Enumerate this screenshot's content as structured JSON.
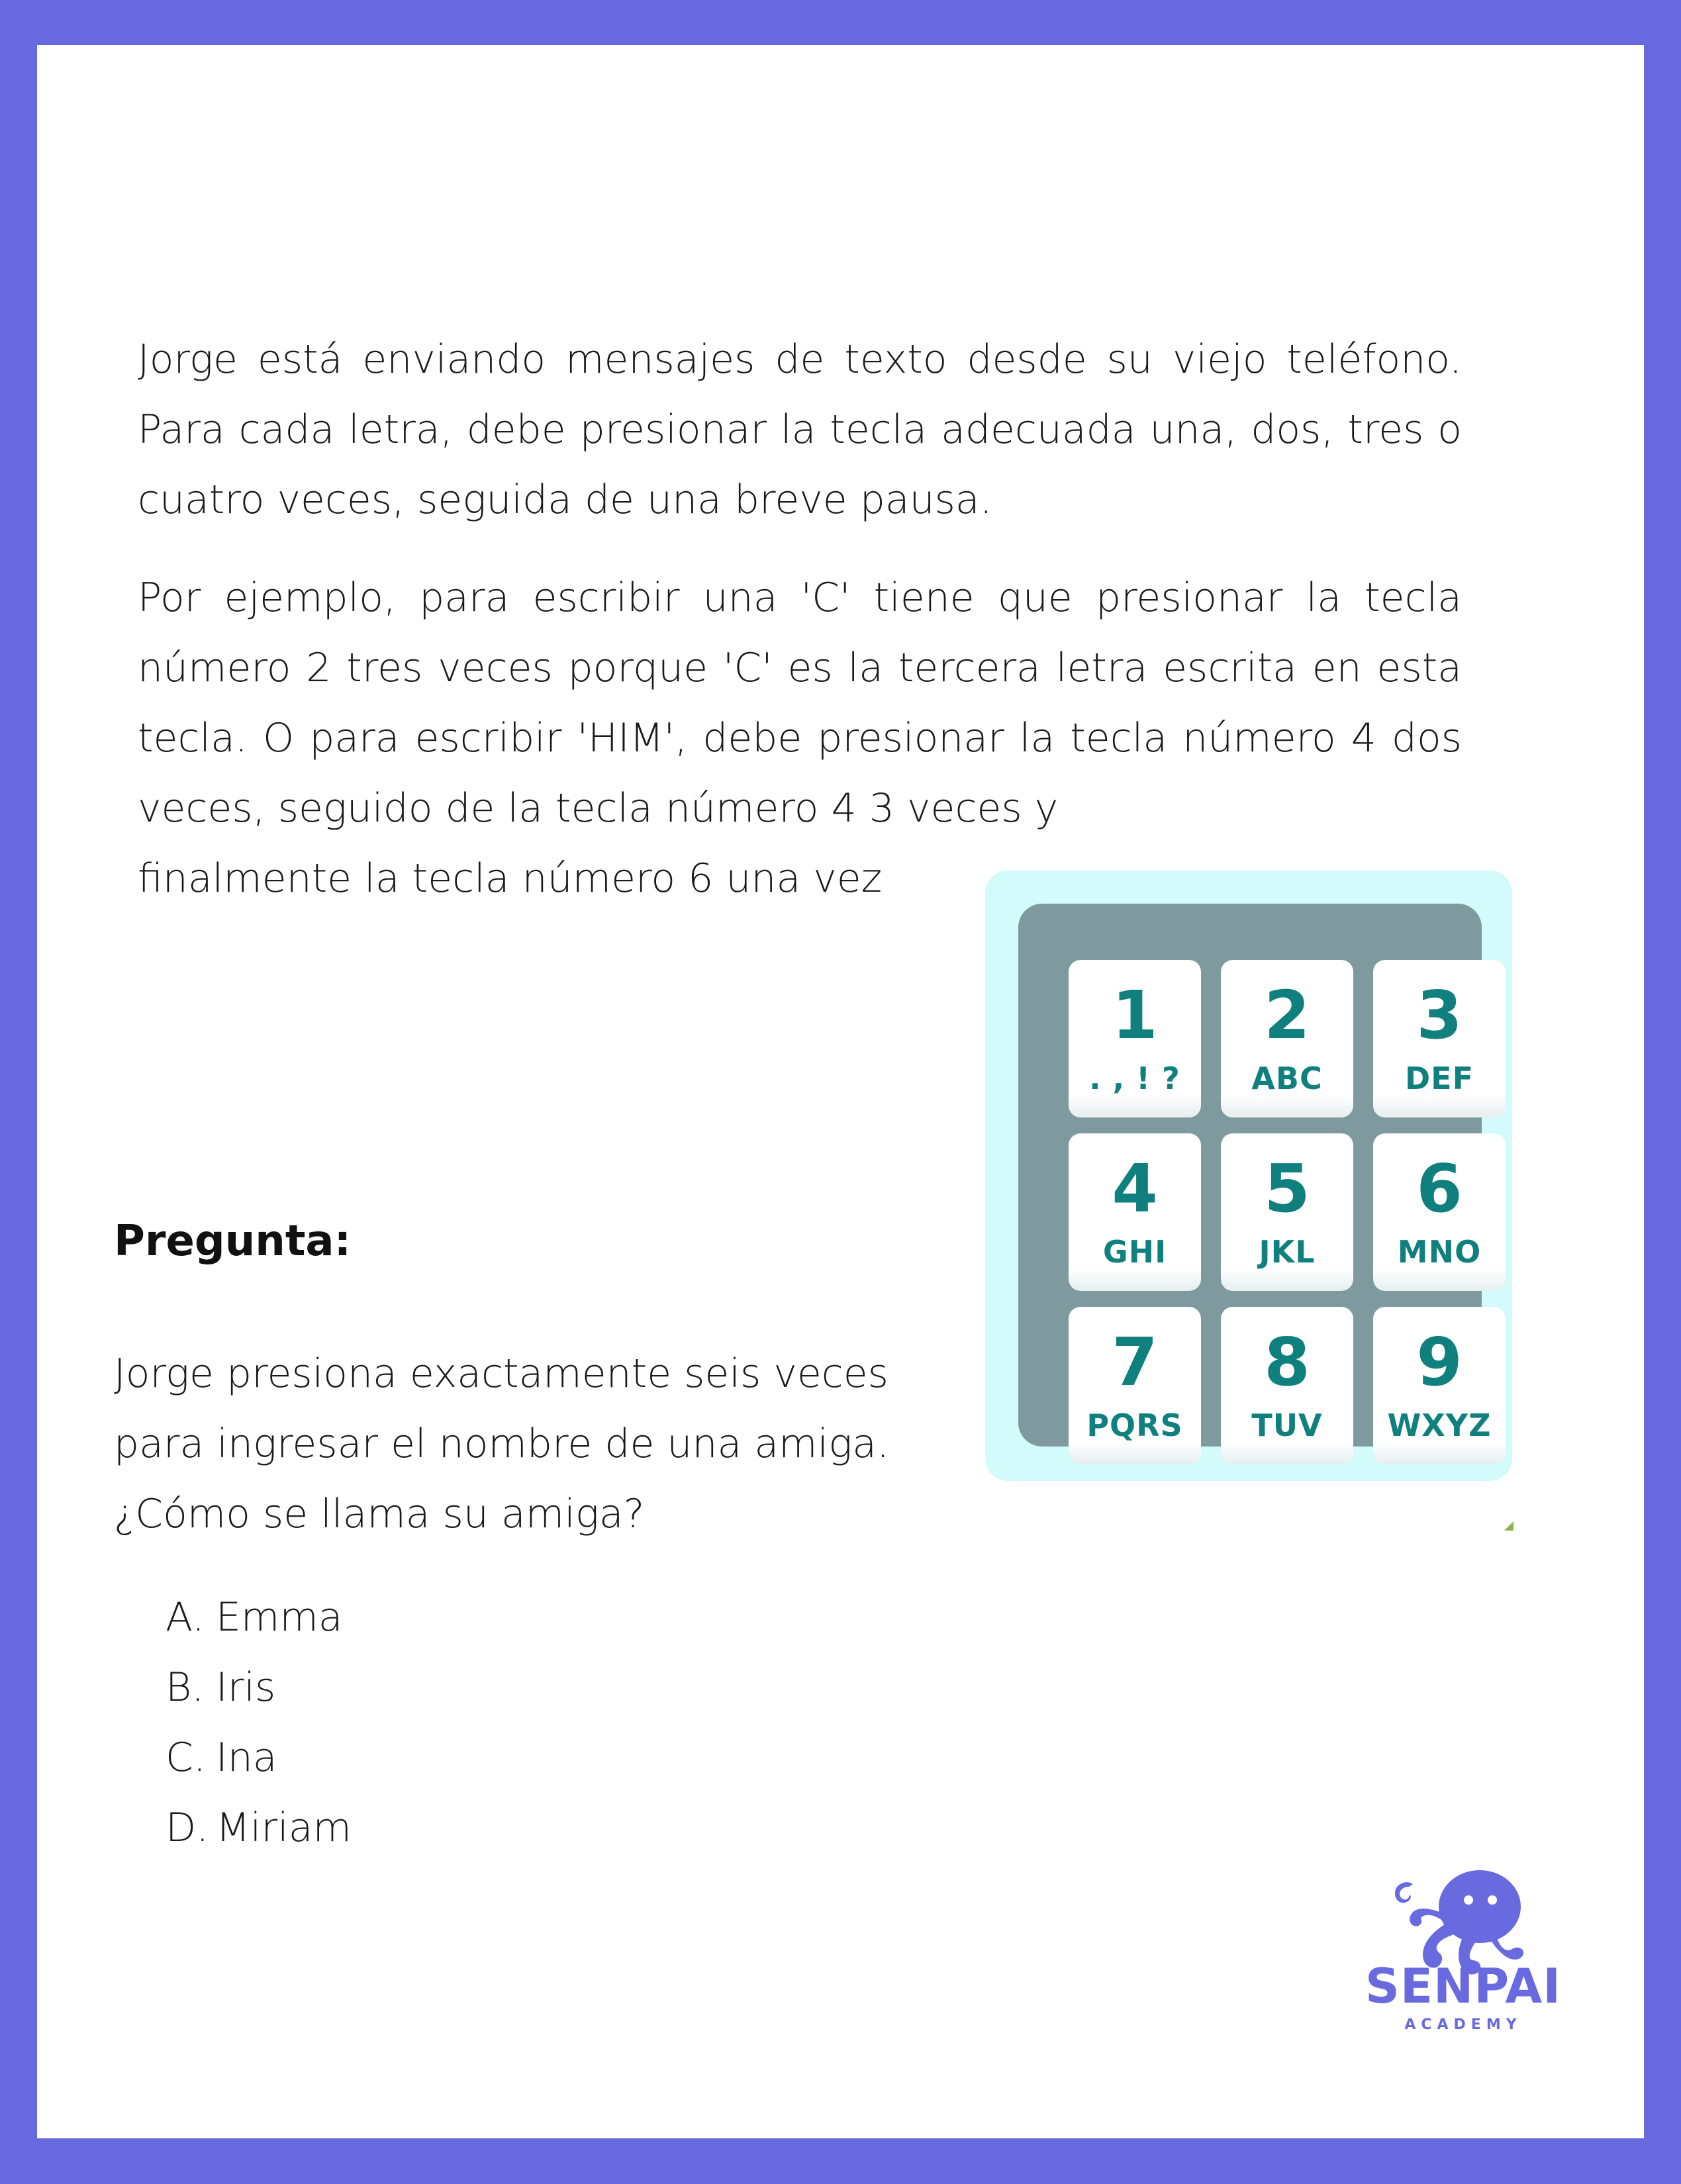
{
  "problem": {
    "paragraph1": "Jorge está enviando mensajes de texto desde su viejo teléfono. Para cada letra, debe presionar la tecla adecuada una, dos, tres o cuatro veces, seguida de una breve pausa.",
    "paragraph2": "Por ejemplo, para escribir una 'C' tiene que presionar la tecla número 2 tres veces porque 'C' es la tercera letra escrita en esta tecla.  O para escribir 'HIM', debe presionar la tecla número 4 dos veces, seguido de la tecla número 4 3 veces y",
    "paragraph2_last": "finalmente la tecla número 6 una vez"
  },
  "question": {
    "heading": "Pregunta:",
    "text_line1": "Jorge presiona exactamente seis veces",
    "text_line2": "para ingresar el nombre de una amiga.",
    "text_line3": "¿Cómo se llama su amiga?",
    "options": [
      {
        "letter": "A.",
        "text": "Emma"
      },
      {
        "letter": "B.",
        "text": "Iris"
      },
      {
        "letter": "C.",
        "text": "Ina"
      },
      {
        "letter": "D.",
        "text": "Miriam"
      }
    ]
  },
  "keypad": {
    "keys": [
      {
        "number": "1",
        "letters": ". , ! ?"
      },
      {
        "number": "2",
        "letters": "ABC"
      },
      {
        "number": "3",
        "letters": "DEF"
      },
      {
        "number": "4",
        "letters": "GHI"
      },
      {
        "number": "5",
        "letters": "JKL"
      },
      {
        "number": "6",
        "letters": "MNO"
      },
      {
        "number": "7",
        "letters": "PQRS"
      },
      {
        "number": "8",
        "letters": "TUV"
      },
      {
        "number": "9",
        "letters": "WXYZ"
      }
    ],
    "colors": {
      "background": "#d3fbfb",
      "frame": "#7f9a9e",
      "key_text": "#10807f"
    }
  },
  "logo": {
    "name": "SENPAI",
    "subtitle": "ACADEMY",
    "icon": "octopus-icon",
    "color": "#6a6ae0"
  },
  "colors": {
    "border": "#6a6ae0",
    "page": "#ffffff"
  }
}
